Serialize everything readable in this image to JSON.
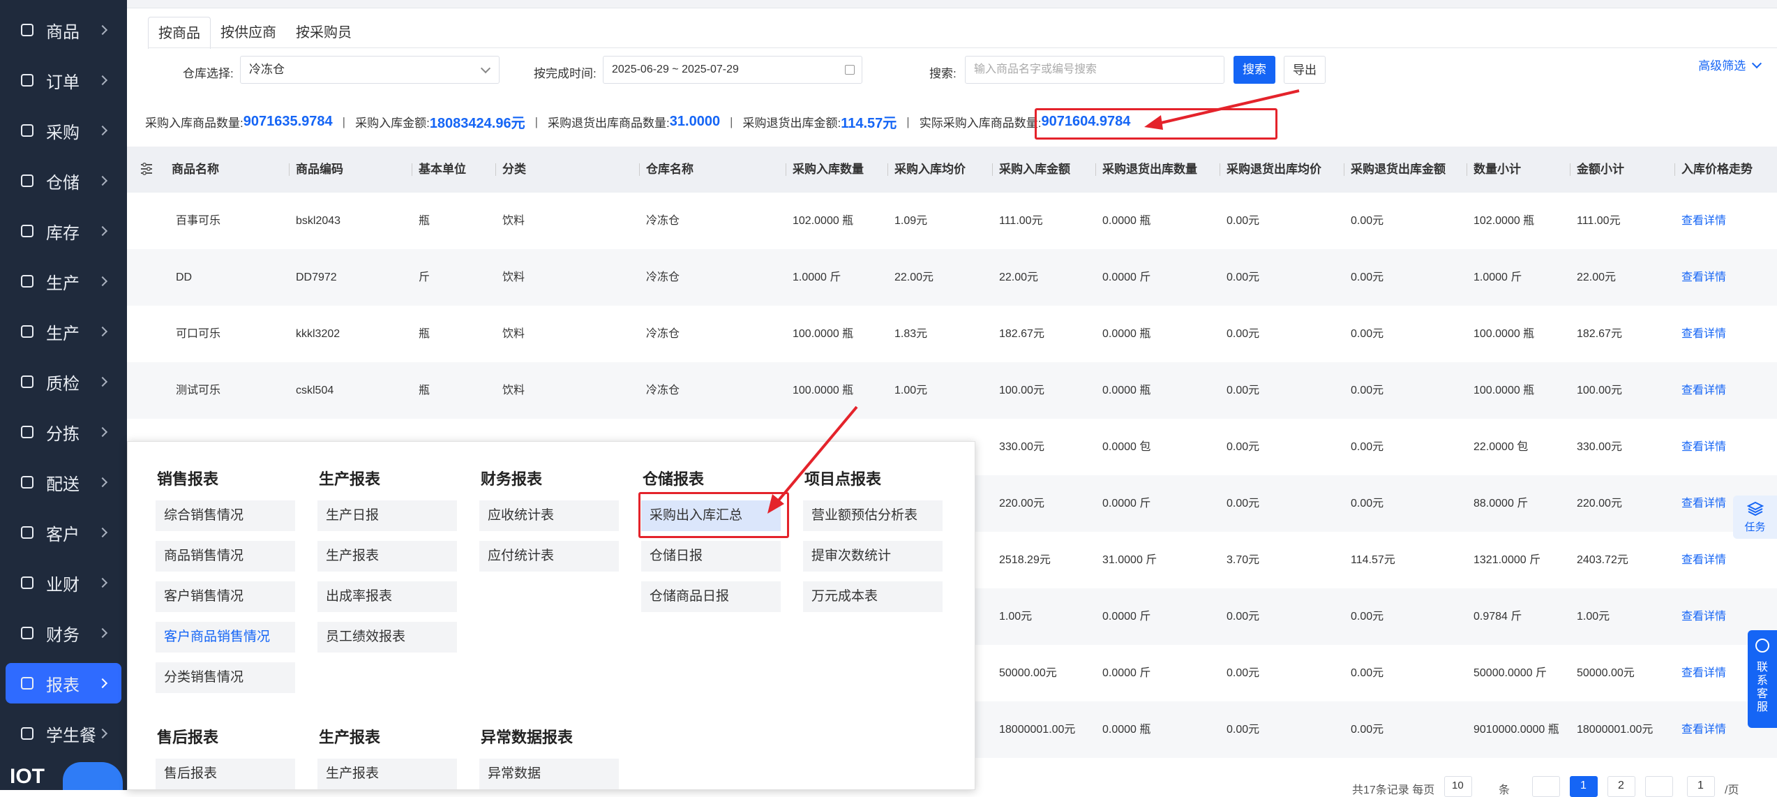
{
  "sidebar": {
    "items": [
      {
        "label": "商品",
        "icon": "grid-icon"
      },
      {
        "label": "订单",
        "icon": "clipboard-icon"
      },
      {
        "label": "采购",
        "icon": "basket-icon"
      },
      {
        "label": "仓储",
        "icon": "warehouse-icon"
      },
      {
        "label": "库存",
        "icon": "warehouse-icon"
      },
      {
        "label": "生产",
        "icon": "factory-icon"
      },
      {
        "label": "生产",
        "icon": "factory-icon"
      },
      {
        "label": "质检",
        "icon": "shield-icon"
      },
      {
        "label": "分拣",
        "icon": "sort-icon"
      },
      {
        "label": "配送",
        "icon": "truck-icon"
      },
      {
        "label": "客户",
        "icon": "user-icon"
      },
      {
        "label": "业财",
        "icon": "ledger-icon"
      },
      {
        "label": "财务",
        "icon": "finance-icon"
      },
      {
        "label": "报表",
        "icon": "pie-chart-icon",
        "active": true
      },
      {
        "label": "学生餐",
        "icon": "bowl-icon"
      }
    ],
    "logo_text": "IOT"
  },
  "tabs": [
    "按商品",
    "按供应商",
    "按采购员"
  ],
  "filters": {
    "warehouse_label": "仓库选择:",
    "warehouse_value": "冷冻仓",
    "time_label": "按完成时间:",
    "time_value": "2025-06-29 ~ 2025-07-29",
    "search_label": "搜索:",
    "search_placeholder": "输入商品名字或编号搜索",
    "search_button": "搜索",
    "export_button": "导出",
    "advanced": "高级筛选"
  },
  "summary": [
    {
      "label": "采购入库商品数量:",
      "value": "9071635.9784"
    },
    {
      "label": "采购入库金额:",
      "value": "18083424.96元"
    },
    {
      "label": "采购退货出库商品数量:",
      "value": "31.0000"
    },
    {
      "label": "采购退货出库金额:",
      "value": "114.57元"
    },
    {
      "label": "实际采购入库商品数量:",
      "value": "9071604.9784"
    }
  ],
  "table": {
    "headers": [
      "商品名称",
      "商品编码",
      "基本单位",
      "分类",
      "仓库名称",
      "采购入库数量",
      "采购入库均价",
      "采购入库金额",
      "采购退货出库数量",
      "采购退货出库均价",
      "采购退货出库金额",
      "数量小计",
      "金额小计",
      "入库价格走势"
    ],
    "rows": [
      [
        "百事可乐",
        "bskl2043",
        "瓶",
        "饮料",
        "冷冻仓",
        "102.0000 瓶",
        "1.09元",
        "111.00元",
        "0.0000 瓶",
        "0.00元",
        "0.00元",
        "102.0000 瓶",
        "111.00元",
        "查看详情"
      ],
      [
        "DD",
        "DD7972",
        "斤",
        "饮料",
        "冷冻仓",
        "1.0000 斤",
        "22.00元",
        "22.00元",
        "0.0000 斤",
        "0.00元",
        "0.00元",
        "1.0000 斤",
        "22.00元",
        "查看详情"
      ],
      [
        "可口可乐",
        "kkkl3202",
        "瓶",
        "饮料",
        "冷冻仓",
        "100.0000 瓶",
        "1.83元",
        "182.67元",
        "0.0000 瓶",
        "0.00元",
        "0.00元",
        "100.0000 瓶",
        "182.67元",
        "查看详情"
      ],
      [
        "测试可乐",
        "cskl504",
        "瓶",
        "饮料",
        "冷冻仓",
        "100.0000 瓶",
        "1.00元",
        "100.00元",
        "0.0000 瓶",
        "0.00元",
        "0.00元",
        "100.0000 瓶",
        "100.00元",
        "查看详情"
      ],
      [
        "",
        "",
        "",
        "",
        "",
        "",
        "",
        "330.00元",
        "0.0000 包",
        "0.00元",
        "0.00元",
        "22.0000 包",
        "330.00元",
        "查看详情"
      ],
      [
        "",
        "",
        "",
        "",
        "",
        "",
        "",
        "220.00元",
        "0.0000 斤",
        "0.00元",
        "0.00元",
        "88.0000 斤",
        "220.00元",
        "查看详情"
      ],
      [
        "",
        "",
        "",
        "",
        "",
        "",
        "",
        "2518.29元",
        "31.0000 斤",
        "3.70元",
        "114.57元",
        "1321.0000 斤",
        "2403.72元",
        "查看详情"
      ],
      [
        "",
        "",
        "",
        "",
        "",
        "",
        "",
        "1.00元",
        "0.0000 斤",
        "0.00元",
        "0.00元",
        "0.9784 斤",
        "1.00元",
        "查看详情"
      ],
      [
        "",
        "",
        "",
        "",
        "",
        "",
        "",
        "50000.00元",
        "0.0000 斤",
        "0.00元",
        "0.00元",
        "50000.0000 斤",
        "50000.00元",
        "查看详情"
      ],
      [
        "",
        "",
        "",
        "",
        "",
        "",
        "",
        "18000001.00元",
        "0.0000 瓶",
        "0.00元",
        "0.00元",
        "9010000.0000 瓶",
        "18000001.00元",
        "查看详情"
      ]
    ]
  },
  "popup": {
    "sections": [
      {
        "title": "销售报表",
        "items": [
          "综合销售情况",
          "商品销售情况",
          "客户销售情况",
          "客户商品销售情况",
          "分类销售情况"
        ]
      },
      {
        "title": "生产报表",
        "items": [
          "生产日报",
          "生产报表",
          "出成率报表",
          "员工绩效报表"
        ]
      },
      {
        "title": "财务报表",
        "items": [
          "应收统计表",
          "应付统计表"
        ]
      },
      {
        "title": "仓储报表",
        "items": [
          "采购出入库汇总",
          "仓储日报",
          "仓储商品日报"
        ]
      },
      {
        "title": "项目点报表",
        "items": [
          "营业额预估分析表",
          "提审次数统计",
          "万元成本表"
        ]
      },
      {
        "title": "售后报表",
        "items": [
          "售后报表"
        ]
      },
      {
        "title": "生产报表",
        "items": [
          "生产报表"
        ]
      },
      {
        "title": "异常数据报表",
        "items": [
          "异常数据"
        ]
      }
    ]
  },
  "float": {
    "task": "任务",
    "service": "联系客服"
  },
  "pager": {
    "summary": "共17条记录 每页",
    "page_size": "10",
    "unit": "条",
    "current": "1",
    "next": "2",
    "goto": "1",
    "goto_suffix": "/页"
  },
  "colors": {
    "accent": "#1565f5",
    "sidebar": "#1f2a3c",
    "highlight": "#e4232b"
  }
}
